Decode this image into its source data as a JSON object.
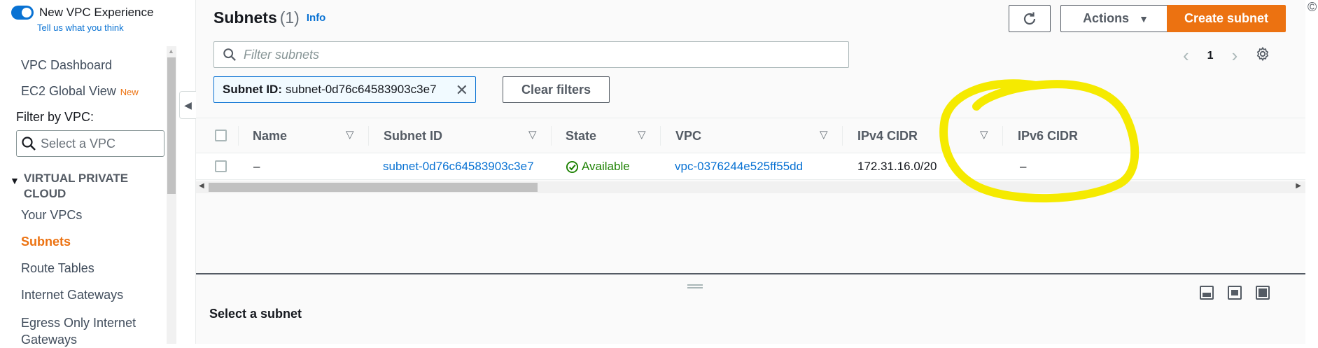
{
  "sidebar": {
    "toggle_label": "New VPC Experience",
    "tell_us": "Tell us what you think",
    "items_top": [
      {
        "label": "VPC Dashboard"
      },
      {
        "label": "EC2 Global View",
        "badge": "New"
      }
    ],
    "filter_label": "Filter by VPC:",
    "vpc_select_placeholder": "Select a VPC",
    "section_title": "VIRTUAL PRIVATE CLOUD",
    "items": [
      {
        "label": "Your VPCs"
      },
      {
        "label": "Subnets",
        "active": true
      },
      {
        "label": "Route Tables"
      },
      {
        "label": "Internet Gateways"
      },
      {
        "label": "Egress Only Internet Gateways"
      }
    ]
  },
  "header": {
    "title": "Subnets",
    "count": "(1)",
    "info": "Info",
    "actions_label": "Actions",
    "create_label": "Create subnet"
  },
  "search": {
    "placeholder": "Filter subnets"
  },
  "pagination": {
    "page": "1"
  },
  "filter_chip": {
    "key": "Subnet ID:",
    "value": "subnet-0d76c64583903c3e7"
  },
  "clear_filters_label": "Clear filters",
  "table": {
    "columns": [
      "Name",
      "Subnet ID",
      "State",
      "VPC",
      "IPv4 CIDR",
      "IPv6 CIDR"
    ],
    "rows": [
      {
        "name": "–",
        "subnet_id": "subnet-0d76c64583903c3e7",
        "state": "Available",
        "vpc": "vpc-0376244e525ff55dd",
        "ipv4_cidr": "172.31.16.0/20",
        "ipv6_cidr": "–"
      }
    ]
  },
  "split_panel": {
    "title": "Select a subnet"
  },
  "colors": {
    "accent_orange": "#ec7211",
    "link_blue": "#0972d3",
    "success_green": "#1d8102",
    "annotation_yellow": "#f5ea00"
  }
}
